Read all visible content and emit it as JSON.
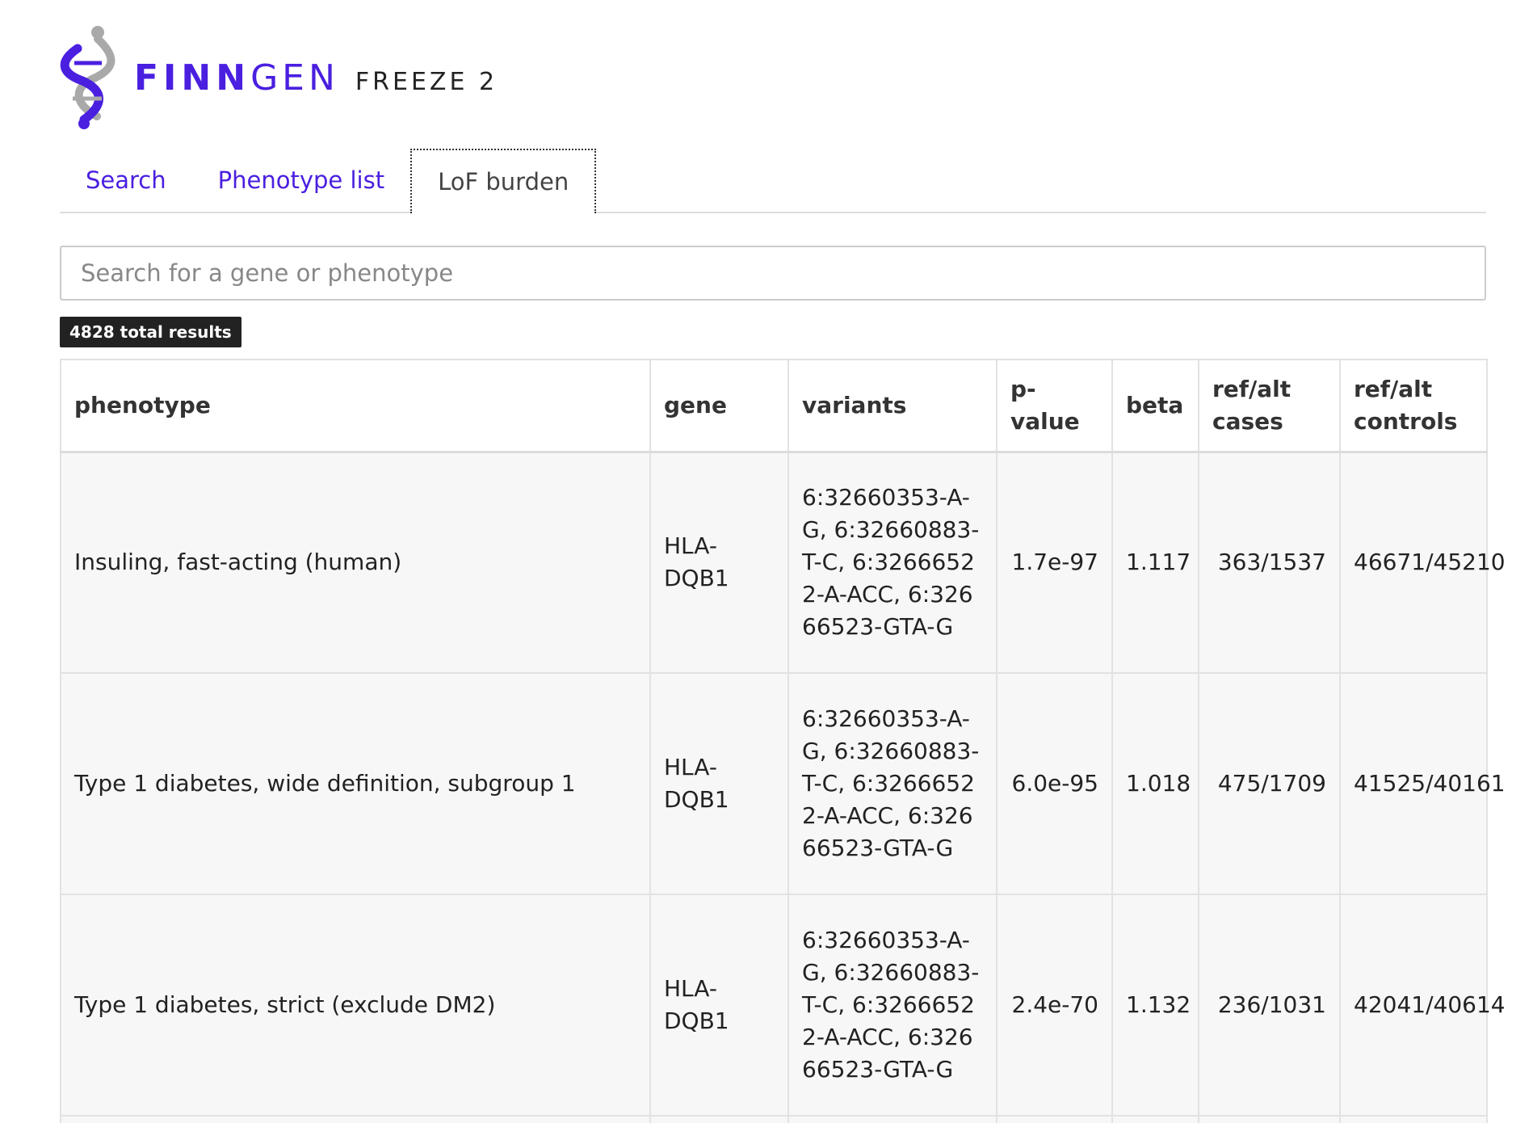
{
  "brand": {
    "name_bold": "FINN",
    "name_light": "GEN",
    "release": "FREEZE 2",
    "colors": {
      "brand_purple": "#4a1fe0",
      "logo_gray": "#a9a9a9"
    }
  },
  "tabs": [
    {
      "label": "Search",
      "active": false
    },
    {
      "label": "Phenotype list",
      "active": false
    },
    {
      "label": "LoF burden",
      "active": true
    }
  ],
  "search": {
    "placeholder": "Search for a gene or phenotype",
    "value": ""
  },
  "results_badge": "4828 total results",
  "table": {
    "headers": [
      "phenotype",
      "gene",
      "variants",
      "p-value",
      "beta",
      "ref/alt cases",
      "ref/alt controls"
    ],
    "rows": [
      {
        "phenotype": "Insuling, fast-acting (human)",
        "gene": "HLA-DQB1",
        "variants": "6:32660353-A-G, 6:32660883-T-C, 6:32666522-A-ACC, 6:32666523-GTA-G",
        "pvalue": "1.7e-97",
        "beta": "1.117",
        "cases": "363/1537",
        "controls": "46671/45210"
      },
      {
        "phenotype": "Type 1 diabetes, wide definition, subgroup 1",
        "gene": "HLA-DQB1",
        "variants": "6:32660353-A-G, 6:32660883-T-C, 6:32666522-A-ACC, 6:32666523-GTA-G",
        "pvalue": "6.0e-95",
        "beta": "1.018",
        "cases": "475/1709",
        "controls": "41525/40161"
      },
      {
        "phenotype": "Type 1 diabetes, strict (exclude DM2)",
        "gene": "HLA-DQB1",
        "variants": "6:32660353-A-G, 6:32660883-T-C, 6:32666522-A-ACC, 6:32666523-GTA-G",
        "pvalue": "2.4e-70",
        "beta": "1.132",
        "cases": "236/1031",
        "controls": "42041/40614"
      }
    ]
  }
}
